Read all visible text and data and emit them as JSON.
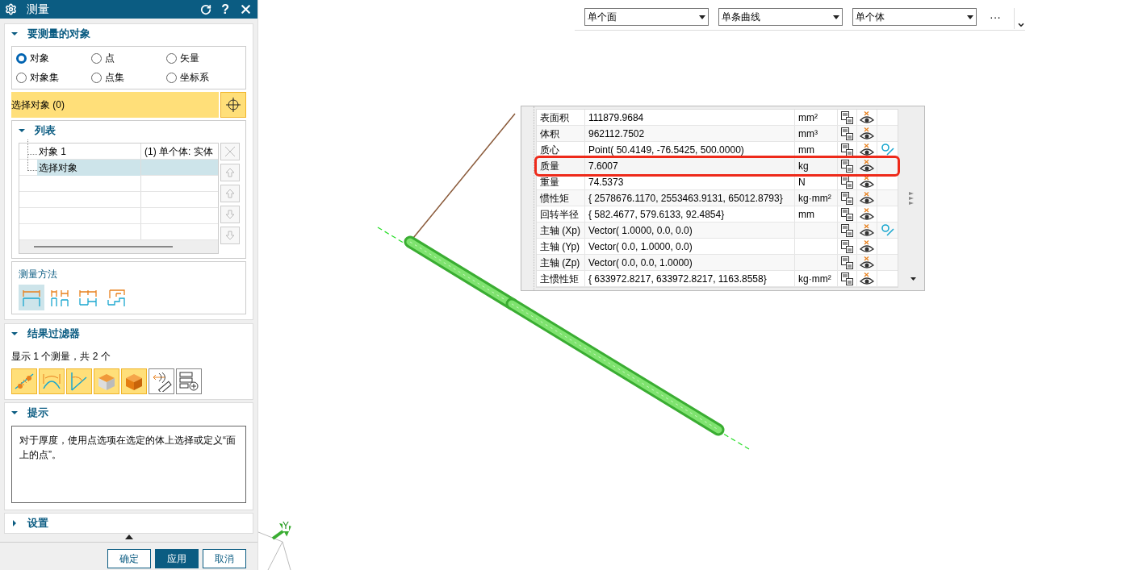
{
  "dialog": {
    "title": "测量",
    "help": "?"
  },
  "sections": [
    {
      "kind": "objects",
      "title": "要测量的对象",
      "expanded": true
    },
    {
      "kind": "filter",
      "title": "结果过滤器",
      "expanded": true
    },
    {
      "kind": "hint",
      "title": "提示",
      "expanded": true
    },
    {
      "kind": "settings",
      "title": "设置",
      "expanded": false
    }
  ],
  "object_types": [
    {
      "label": "对象",
      "selected": true
    },
    {
      "label": "点",
      "selected": false
    },
    {
      "label": "矢量",
      "selected": false
    },
    {
      "label": "对象集",
      "selected": false
    },
    {
      "label": "点集",
      "selected": false
    },
    {
      "label": "坐标系",
      "selected": false
    }
  ],
  "select_bar": {
    "label": "选择对象 (0)"
  },
  "list": {
    "title": "列表",
    "expanded": true,
    "rows": [
      {
        "name": "对象 1",
        "value": "(1) 单个体: 实体",
        "selected": false
      },
      {
        "name": "选择对象",
        "selected": true
      }
    ]
  },
  "method": {
    "title": "测量方法",
    "options": [
      {
        "selected": true
      },
      {
        "selected": false
      },
      {
        "selected": false
      },
      {
        "selected": false
      }
    ]
  },
  "filter": {
    "summary": "显示 1 个测量，共 2 个",
    "buttons": [
      {
        "kind": "distance",
        "selected": true
      },
      {
        "kind": "arc",
        "selected": true
      },
      {
        "kind": "angle",
        "selected": true
      },
      {
        "kind": "face",
        "selected": true
      },
      {
        "kind": "solid",
        "selected": true
      },
      {
        "kind": "ruler",
        "selected": false
      },
      {
        "kind": "list-add",
        "selected": false
      }
    ]
  },
  "hint": {
    "text": "对于厚度，使用点选项在选定的体上选择或定义“面上的点”。"
  },
  "footer": {
    "buttons": [
      {
        "label": "确定",
        "primary": false
      },
      {
        "label": "应用",
        "primary": true
      },
      {
        "label": "取消",
        "primary": false
      }
    ]
  },
  "toolbar": {
    "filters": [
      "单个面",
      "单条曲线",
      "单个体"
    ],
    "more": "···"
  },
  "results": {
    "rows": [
      {
        "name": "表面积",
        "value": "111879.9684",
        "unit": "mm²",
        "locate": false,
        "highlighted": false
      },
      {
        "name": "体积",
        "value": "962112.7502",
        "unit": "mm³",
        "locate": false,
        "highlighted": false
      },
      {
        "name": "质心",
        "value": "Point( 50.4149, -76.5425, 500.0000)",
        "unit": "mm",
        "locate": true,
        "highlighted": false
      },
      {
        "name": "质量",
        "value": "7.6007",
        "unit": "kg",
        "locate": false,
        "highlighted": true
      },
      {
        "name": "重量",
        "value": "74.5373",
        "unit": "N",
        "locate": false,
        "highlighted": false
      },
      {
        "name": "惯性矩",
        "value": "{ 2578676.1170, 2553463.9131, 65012.8793}",
        "unit": "kg·mm²",
        "locate": false,
        "highlighted": false
      },
      {
        "name": "回转半径",
        "value": "{ 582.4677, 579.6133, 92.4854}",
        "unit": "mm",
        "locate": false,
        "highlighted": false
      },
      {
        "name": "主轴 (Xp)",
        "value": "Vector( 1.0000, 0.0, 0.0)",
        "locate": true,
        "highlighted": false
      },
      {
        "name": "主轴 (Yp)",
        "value": "Vector( 0.0, 1.0000, 0.0)",
        "locate": false,
        "highlighted": false
      },
      {
        "name": "主轴 (Zp)",
        "value": "Vector( 0.0, 0.0, 1.0000)",
        "locate": false,
        "highlighted": false
      },
      {
        "name": "主惯性矩",
        "value": "{ 633972.8217, 633972.8217, 1163.8558}",
        "unit": "kg·mm²",
        "locate": false,
        "highlighted": false
      }
    ]
  },
  "triad": {
    "axis_label": "Y"
  }
}
